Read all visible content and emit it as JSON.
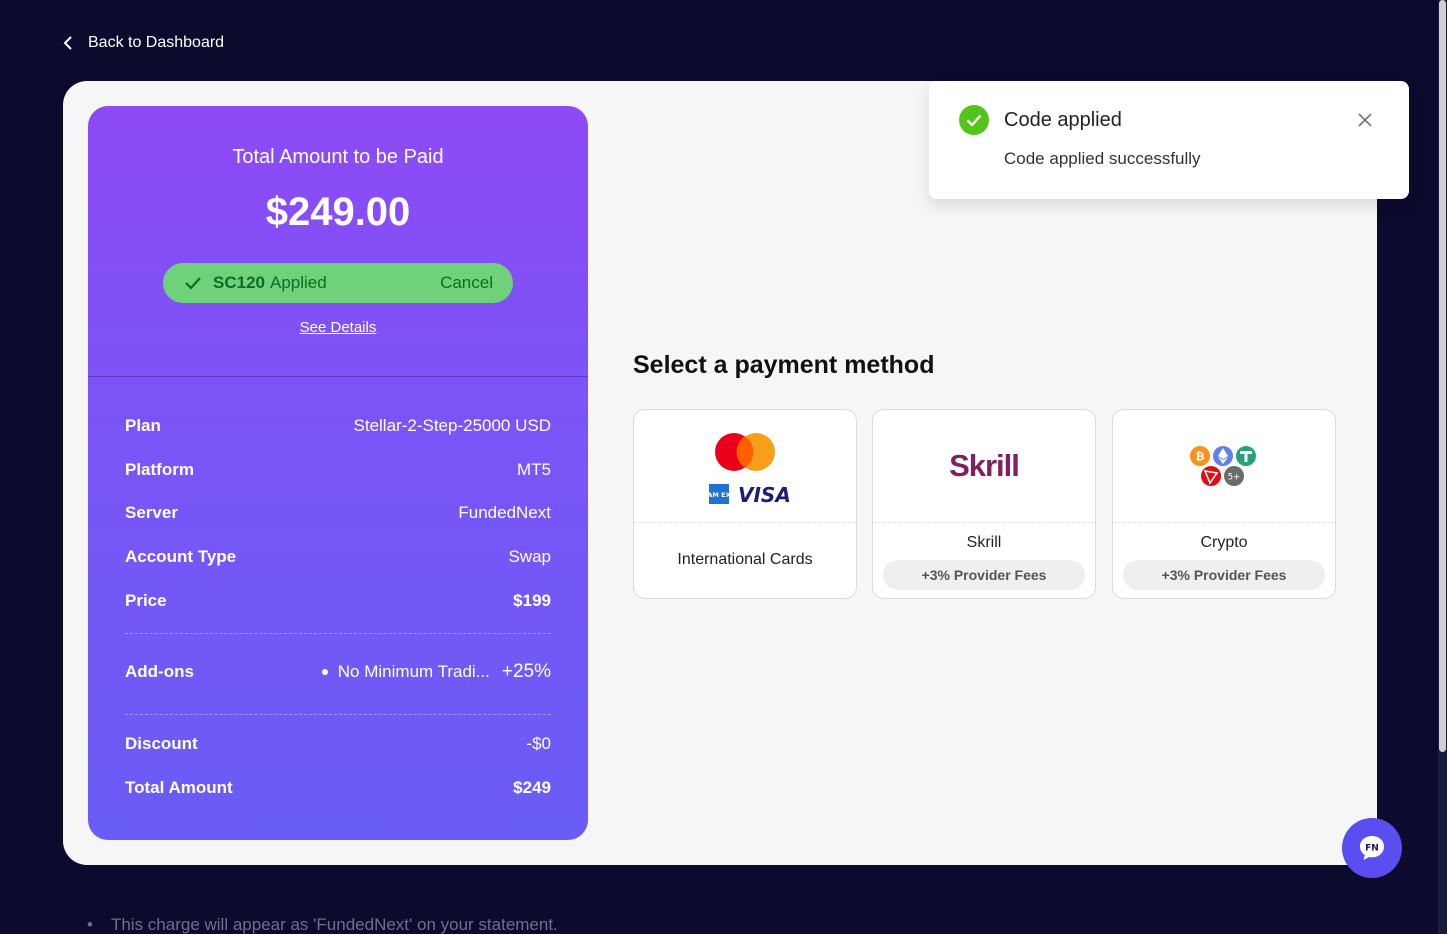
{
  "nav": {
    "back_label": "Back to Dashboard"
  },
  "summary": {
    "total_label": "Total Amount to be Paid",
    "total_amount": "$249.00",
    "promo": {
      "code": "SC120",
      "status": "Applied",
      "cancel_label": "Cancel"
    },
    "see_details": "See Details",
    "rows": [
      {
        "label": "Plan",
        "value": "Stellar-2-Step-25000 USD"
      },
      {
        "label": "Platform",
        "value": "MT5"
      },
      {
        "label": "Server",
        "value": "FundedNext"
      },
      {
        "label": "Account Type",
        "value": "Swap"
      },
      {
        "label": "Price",
        "value": "$199"
      }
    ],
    "addons": {
      "label": "Add-ons",
      "item": "No Minimum Tradi...",
      "percent": "+25%"
    },
    "discount": {
      "label": "Discount",
      "value": "-$0"
    },
    "total": {
      "label": "Total Amount",
      "value": "$249"
    }
  },
  "payment": {
    "title": "Select a payment method",
    "options": [
      {
        "name": "International Cards",
        "fee": "",
        "icons": [
          "mastercard-icon",
          "amex-icon",
          "visa-icon"
        ],
        "card_brand_text": "VISA",
        "amex_text": "AM EX"
      },
      {
        "name": "Skrill",
        "fee": "+3% Provider Fees",
        "logo_text": "Skrill"
      },
      {
        "name": "Crypto",
        "fee": "+3% Provider Fees",
        "more_text": "5+"
      }
    ]
  },
  "toast": {
    "title": "Code applied",
    "message": "Code applied successfully"
  },
  "footer": {
    "note": "This charge will appear as 'FundedNext' on your statement."
  },
  "chat": {
    "label": "FN"
  },
  "colors": {
    "accent": "#8d4af7",
    "success": "#52c41a",
    "promo_bg": "#6fd27b",
    "skrill": "#7f2060",
    "chat": "#5b4ef0"
  }
}
